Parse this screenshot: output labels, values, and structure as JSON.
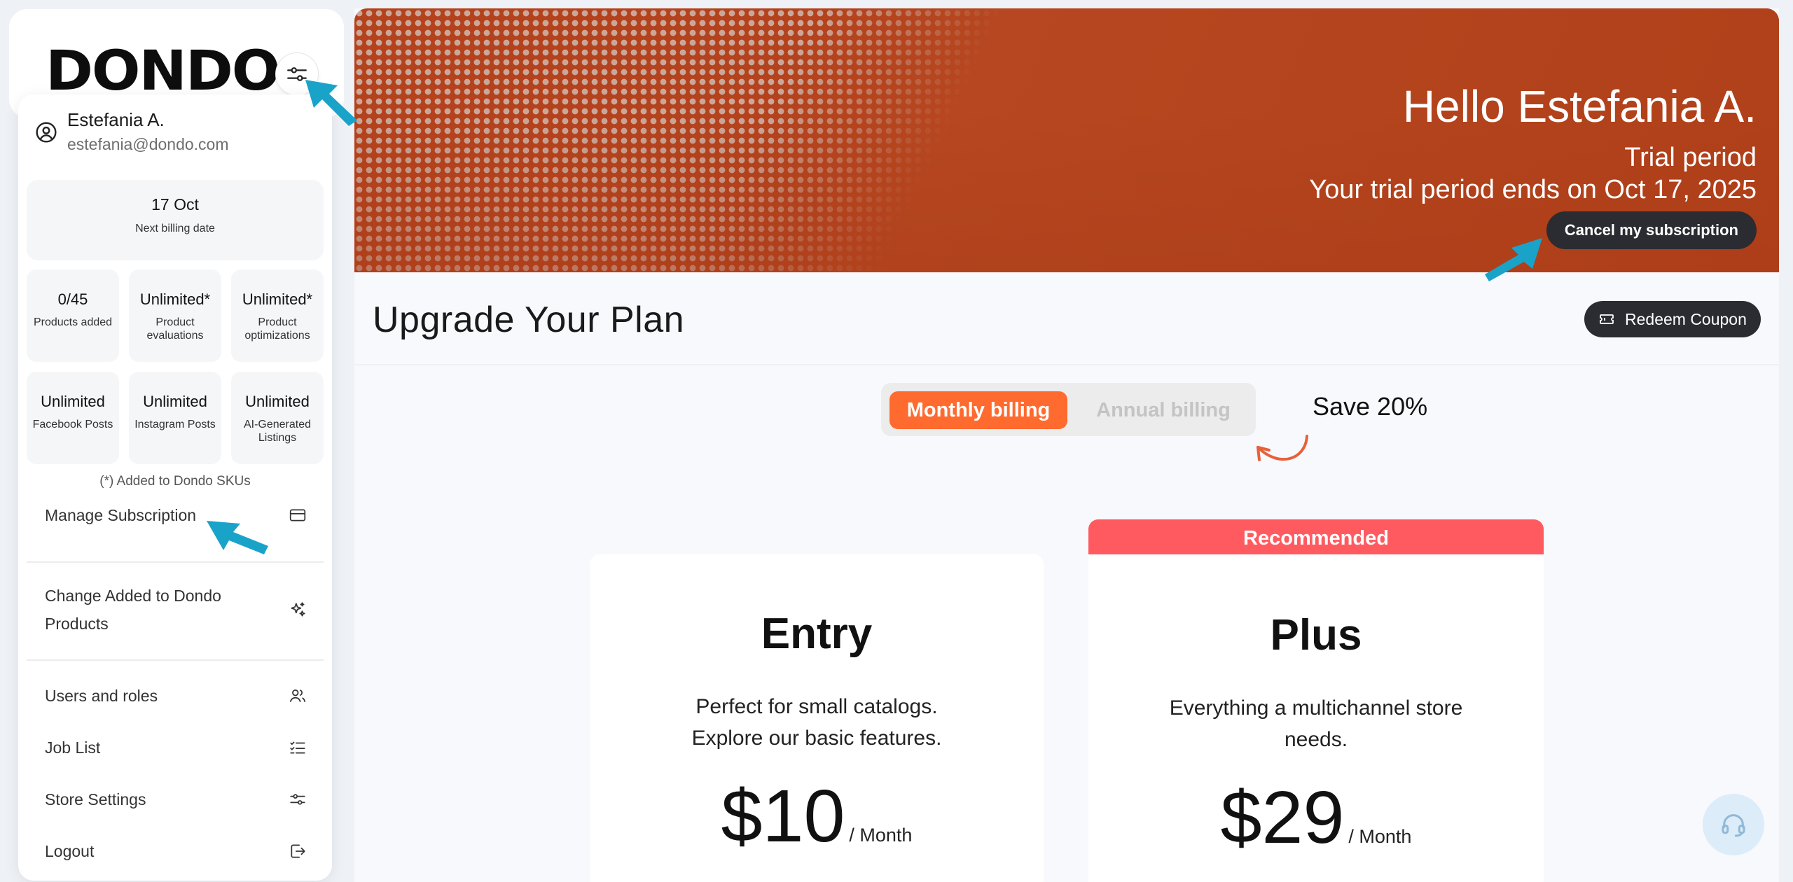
{
  "sidebar": {
    "logo": "DONDO",
    "user": {
      "name": "Estefania A.",
      "email": "estefania@dondo.com"
    },
    "billing": {
      "date": "17 Oct",
      "label": "Next billing date"
    },
    "stats": [
      {
        "value": "0/45",
        "label": "Products added"
      },
      {
        "value": "Unlimited*",
        "label": "Product evaluations"
      },
      {
        "value": "Unlimited*",
        "label": "Product optimizations"
      },
      {
        "value": "Unlimited",
        "label": "Facebook Posts"
      },
      {
        "value": "Unlimited",
        "label": "Instagram Posts"
      },
      {
        "value": "Unlimited",
        "label": "AI-Generated Listings"
      }
    ],
    "note": "(*) Added to Dondo SKUs",
    "menu": {
      "manage": "Manage Subscription",
      "change": "Change Added to Dondo Products",
      "users": "Users and roles",
      "jobs": "Job List",
      "store": "Store Settings",
      "logout": "Logout"
    }
  },
  "banner": {
    "greeting": "Hello Estefania A.",
    "status": "Trial period",
    "trial_end": "Your trial period ends on Oct 17, 2025",
    "cancel_label": "Cancel my subscription"
  },
  "upgrade": {
    "title": "Upgrade Your Plan",
    "coupon_label": "Redeem Coupon",
    "billing_toggle": {
      "monthly": "Monthly billing",
      "annual": "Annual billing",
      "selected": "monthly"
    },
    "save_label": "Save 20%",
    "recommended_label": "Recommended",
    "plans": [
      {
        "name": "Entry",
        "description": "Perfect for small catalogs. Explore our basic features.",
        "price": "$10",
        "period": "/ Month"
      },
      {
        "name": "Plus",
        "description": "Everything a multichannel store needs.",
        "price": "$29",
        "period": "/ Month"
      }
    ]
  },
  "colors": {
    "accent_orange": "#ff6a2f",
    "recommended_red": "#ff5a5f",
    "banner_rust": "#b4421d",
    "dark_button": "#2a2c31",
    "annotation_arrow": "#1aa3c8"
  },
  "icons": [
    "filter-sliders-icon",
    "user-circle-icon",
    "credit-card-icon",
    "sparkles-icon",
    "users-icon",
    "checklist-icon",
    "settings-sliders-icon",
    "logout-icon",
    "ticket-icon",
    "headset-icon"
  ]
}
